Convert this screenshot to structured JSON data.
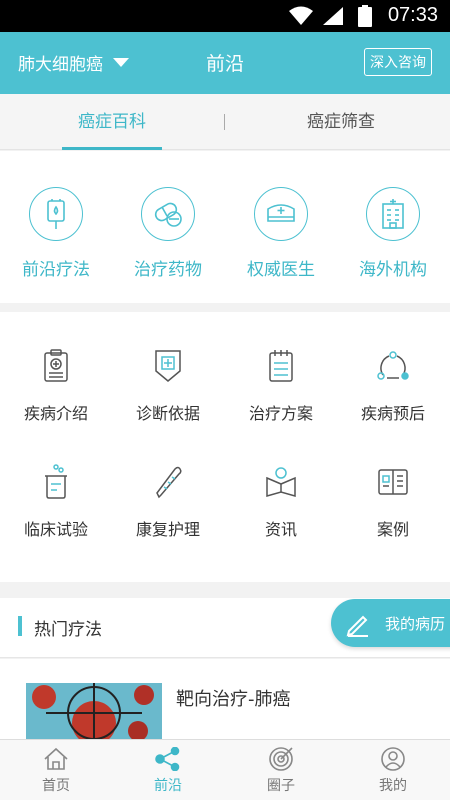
{
  "status_bar": {
    "time": "07:33"
  },
  "header": {
    "cancer_type": "肺大细胞癌",
    "title": "前沿",
    "consult_button": "深入咨询"
  },
  "tabs": [
    {
      "label": "癌症百科",
      "active": true
    },
    {
      "label": "癌症筛查",
      "active": false
    }
  ],
  "categories": [
    {
      "label": "前沿疗法",
      "icon": "iv-bag-icon"
    },
    {
      "label": "治疗药物",
      "icon": "pill-icon"
    },
    {
      "label": "权威医生",
      "icon": "nurse-cap-icon"
    },
    {
      "label": "海外机构",
      "icon": "hospital-icon"
    }
  ],
  "grid": [
    {
      "label": "疾病介绍",
      "icon": "medical-report-icon"
    },
    {
      "label": "诊断依据",
      "icon": "shield-cross-icon"
    },
    {
      "label": "治疗方案",
      "icon": "notepad-icon"
    },
    {
      "label": "疾病预后",
      "icon": "cycle-icon"
    },
    {
      "label": "临床试验",
      "icon": "beaker-icon"
    },
    {
      "label": "康复护理",
      "icon": "thermometer-icon"
    },
    {
      "label": "资讯",
      "icon": "news-icon"
    },
    {
      "label": "案例",
      "icon": "case-book-icon"
    }
  ],
  "hot": {
    "title": "热门疗法",
    "record_button": "我的病历",
    "article_title": "靶向治疗-肺癌"
  },
  "tabbar": [
    {
      "label": "首页",
      "icon": "home-icon",
      "active": false
    },
    {
      "label": "前沿",
      "icon": "share-nodes-icon",
      "active": true
    },
    {
      "label": "圈子",
      "icon": "target-icon",
      "active": false
    },
    {
      "label": "我的",
      "icon": "user-icon",
      "active": false
    }
  ],
  "colors": {
    "accent": "#4dc1d1",
    "accent_text": "#3eb7c8"
  }
}
